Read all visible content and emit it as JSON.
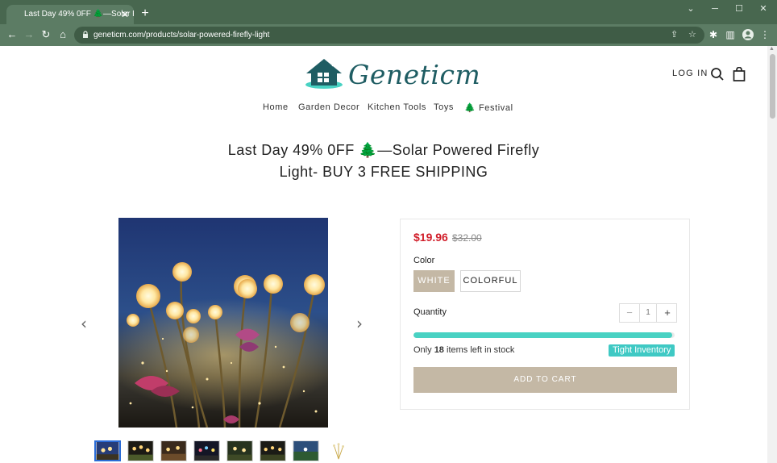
{
  "browser": {
    "tab_title": "Last Day 49% 0FF 🌲—Solar Powered Firefly Light",
    "url": "geneticm.com/products/solar-powered-firefly-light"
  },
  "header": {
    "logo_text": "Geneticm",
    "login_label": "LOG IN"
  },
  "nav": {
    "items": [
      "Home",
      "Garden Decor",
      "Kitchen Tools",
      "Toys",
      "🌲 Festival"
    ]
  },
  "product": {
    "title_line1": "Last Day 49% 0FF 🌲—Solar Powered Firefly",
    "title_line2": "Light- BUY 3 FREE SHIPPING",
    "price": "$19.96",
    "compare_price": "$32.00",
    "color_label": "Color",
    "colors": [
      "WHITE",
      "COLORFUL"
    ],
    "quantity_label": "Quantity",
    "quantity_value": "1",
    "qty_minus": "−",
    "qty_plus": "+",
    "stock_prefix": "Only",
    "stock_count": "18",
    "stock_suffix": "items left in stock",
    "stock_level": 0.99,
    "badge": "Tight Inventory",
    "add_to_cart": "ADD TO CART"
  },
  "icons": {
    "search": "search-icon",
    "cart": "bag-icon",
    "prev": "chevron-left-icon",
    "next": "chevron-right-icon"
  },
  "colors": {
    "chrome": "#48674f",
    "price": "#d11e2a",
    "accent_beige": "#c4b8a5",
    "progress": "#49d2c3",
    "badge": "#3fc9c4",
    "logo": "#1f5d63"
  }
}
